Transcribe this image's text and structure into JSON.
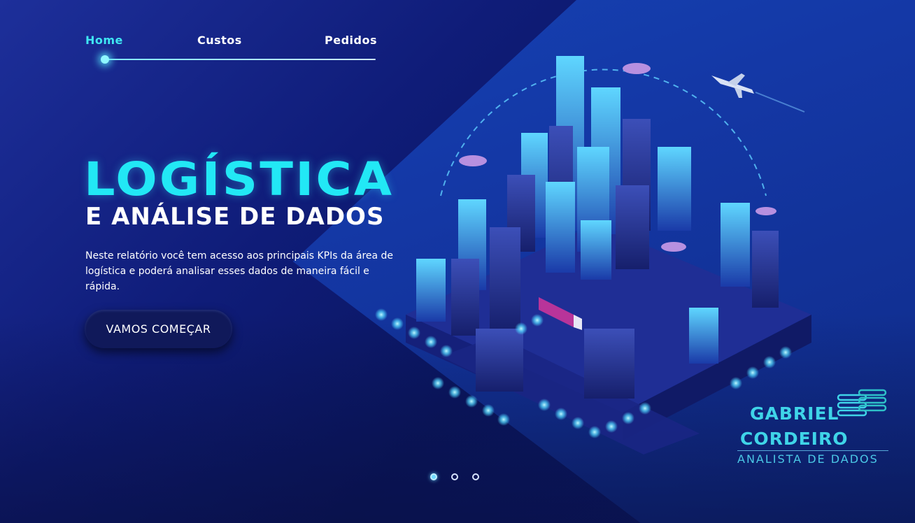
{
  "nav": {
    "items": [
      {
        "label": "Home",
        "active": true
      },
      {
        "label": "Custos",
        "active": false
      },
      {
        "label": "Pedidos",
        "active": false
      }
    ]
  },
  "hero": {
    "title": "LOGÍSTICA",
    "subtitle": "E ANÁLISE DE DADOS",
    "description": "Neste relatório você tem acesso aos principais KPIs da área de logística e poderá analisar esses dados de maneira fácil e rápida.",
    "cta_label": "VAMOS COMEÇAR"
  },
  "pagination": {
    "count": 3,
    "active_index": 0
  },
  "logo": {
    "line1": "GABRIEL",
    "line2": "CORDEIRO",
    "role": "ANALISTA DE DADOS"
  },
  "colors": {
    "accent_cyan": "#22e8f5",
    "background": "#0f1c78",
    "logo_teal": "#3fd4e8"
  },
  "icons": [
    "smart-city-illustration",
    "airplane-icon",
    "drone-icon",
    "truck-icon",
    "logo-database-icon"
  ]
}
